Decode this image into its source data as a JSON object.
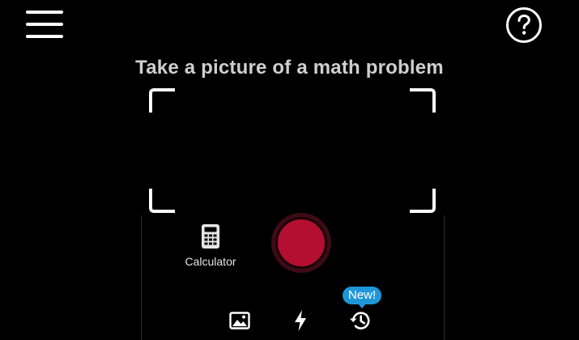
{
  "header": {
    "menu_icon": "hamburger-menu-icon",
    "help_icon": "question-mark-icon"
  },
  "camera": {
    "prompt": "Take a picture of a math problem"
  },
  "calculator": {
    "icon": "calculator-icon",
    "label": "Calculator"
  },
  "shutter": {
    "color": "#b40f30"
  },
  "toolbar": {
    "gallery_icon": "image-gallery-icon",
    "flash_icon": "flash-icon",
    "history_icon": "history-icon",
    "history_badge": "New!",
    "badge_color": "#1e97d9"
  }
}
